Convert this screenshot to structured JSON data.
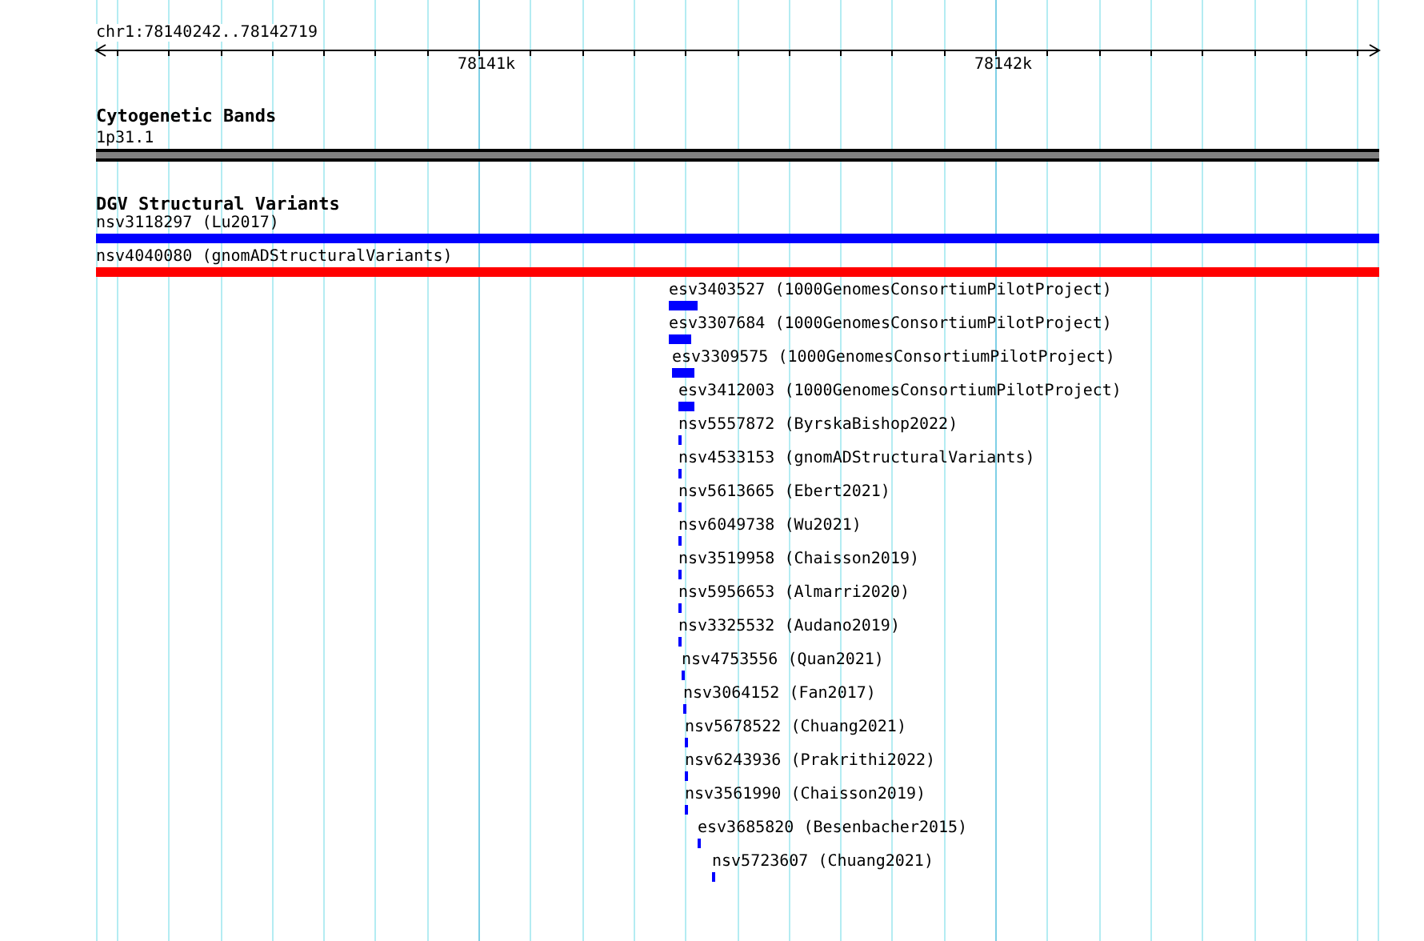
{
  "ruler": {
    "location": "chr1:78140242..78142719",
    "ticks": [
      "78141k",
      "78142k"
    ]
  },
  "tracks": [
    {
      "kind": "cytoband",
      "title": "Cytogenetic Bands",
      "features": [
        {
          "label": "1p31.1"
        }
      ]
    },
    {
      "kind": "variants",
      "title": "DGV Structural Variants",
      "features": [
        {
          "label": "nsv3118297 (Lu2017)",
          "color": "#0000ff"
        },
        {
          "label": "nsv4040080 (gnomADStructuralVariants)",
          "color": "#ff0000"
        },
        {
          "label": "esv3403527 (1000GenomesConsortiumPilotProject)",
          "color": "#0000ff"
        },
        {
          "label": "esv3307684 (1000GenomesConsortiumPilotProject)",
          "color": "#0000ff"
        },
        {
          "label": "esv3309575 (1000GenomesConsortiumPilotProject)",
          "color": "#0000ff"
        },
        {
          "label": "esv3412003 (1000GenomesConsortiumPilotProject)",
          "color": "#0000ff"
        },
        {
          "label": "nsv5557872 (ByrskaBishop2022)",
          "color": "#0000ff"
        },
        {
          "label": "nsv4533153 (gnomADStructuralVariants)",
          "color": "#0000ff"
        },
        {
          "label": "nsv5613665 (Ebert2021)",
          "color": "#0000ff"
        },
        {
          "label": "nsv6049738 (Wu2021)",
          "color": "#0000ff"
        },
        {
          "label": "nsv3519958 (Chaisson2019)",
          "color": "#0000ff"
        },
        {
          "label": "nsv5956653 (Almarri2020)",
          "color": "#0000ff"
        },
        {
          "label": "nsv3325532 (Audano2019)",
          "color": "#0000ff"
        },
        {
          "label": "nsv4753556 (Quan2021)",
          "color": "#0000ff"
        },
        {
          "label": "nsv3064152 (Fan2017)",
          "color": "#0000ff"
        },
        {
          "label": "nsv5678522 (Chuang2021)",
          "color": "#0000ff"
        },
        {
          "label": "nsv6243936 (Prakrithi2022)",
          "color": "#0000ff"
        },
        {
          "label": "nsv3561990 (Chaisson2019)",
          "color": "#0000ff"
        },
        {
          "label": "esv3685820 (Besenbacher2015)",
          "color": "#0000ff"
        },
        {
          "label": "nsv5723607 (Chuang2021)",
          "color": "#0000ff"
        }
      ]
    }
  ]
}
